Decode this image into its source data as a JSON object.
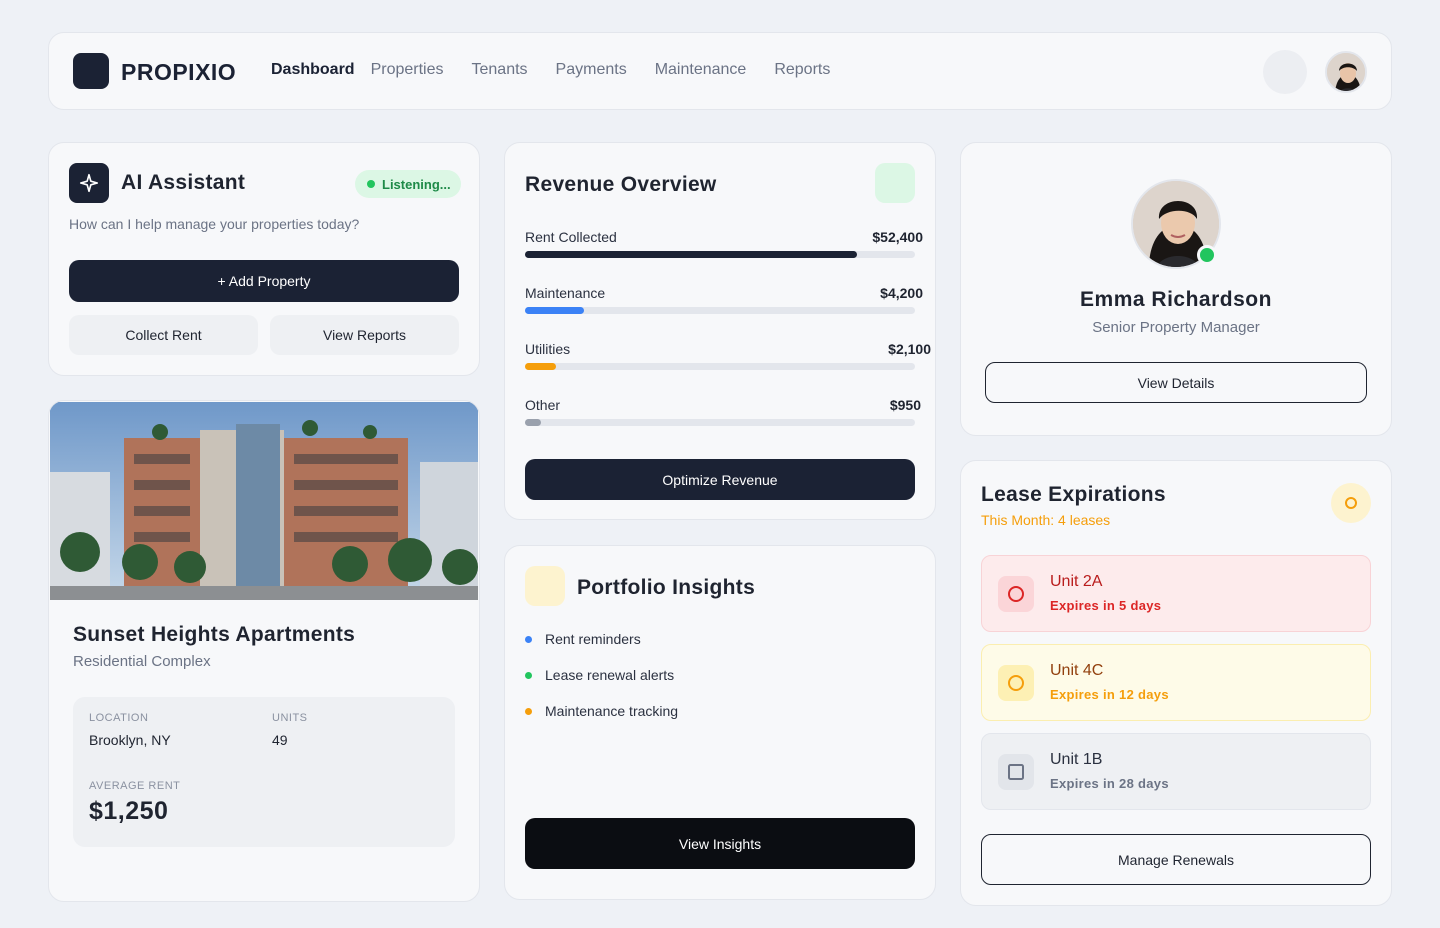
{
  "brand": {
    "name": "PROPIXIO"
  },
  "nav": {
    "links": [
      {
        "label": "Dashboard",
        "active": true
      },
      {
        "label": "Properties"
      },
      {
        "label": "Tenants"
      },
      {
        "label": "Payments"
      },
      {
        "label": "Maintenance"
      },
      {
        "label": "Reports"
      }
    ]
  },
  "ai_assistant": {
    "title": "AI Assistant",
    "status": "Listening...",
    "subtitle": "How can I help manage your properties today?",
    "primary_action": "+ Add Property",
    "secondary_actions": [
      "Collect Rent",
      "View Reports"
    ]
  },
  "property": {
    "name": "Sunset Heights Apartments",
    "type": "Residential Complex",
    "location_label": "LOCATION",
    "location": "Brooklyn, NY",
    "units_label": "UNITS",
    "units": "49",
    "avg_rent_label": "AVERAGE RENT",
    "avg_rent": "$1,250"
  },
  "revenue": {
    "title": "Revenue Overview",
    "rows": [
      {
        "label": "Rent Collected",
        "amount": "$52,400",
        "fill": 0.85,
        "color": "#1b2234"
      },
      {
        "label": "Maintenance",
        "amount": "$4,200",
        "fill": 0.15,
        "color": "#3b82f6"
      },
      {
        "label": "Utilities",
        "amount": "$2,100",
        "fill": 0.08,
        "color": "#f59e0b"
      },
      {
        "label": "Other",
        "amount": "$950",
        "fill": 0.04,
        "color": "#9aa1ad"
      }
    ],
    "action": "Optimize Revenue"
  },
  "insights": {
    "title": "Portfolio Insights",
    "items": [
      {
        "label": "Rent reminders",
        "color": "#3b82f6"
      },
      {
        "label": "Lease renewal alerts",
        "color": "#22c55e"
      },
      {
        "label": "Maintenance tracking",
        "color": "#f59e0b"
      }
    ],
    "action": "View Insights"
  },
  "profile": {
    "name": "Emma Richardson",
    "role": "Senior Property Manager",
    "action": "View Details"
  },
  "leases": {
    "title": "Lease Expirations",
    "subtitle": "This Month: 4 leases",
    "items": [
      {
        "unit": "Unit 2A",
        "expires": "Expires in 5 days",
        "bg": "#fdebec",
        "border": "#f8d3d6",
        "icon_bg": "#fbd5d8",
        "accent": "#dc2626",
        "unit_color": "#b91c1c",
        "icon": "circle"
      },
      {
        "unit": "Unit 4C",
        "expires": "Expires in 12 days",
        "bg": "#fefbe8",
        "border": "#fbeeb0",
        "icon_bg": "#fdf0b4",
        "accent": "#f59e0b",
        "unit_color": "#92400e",
        "icon": "circle"
      },
      {
        "unit": "Unit 1B",
        "expires": "Expires in 28 days",
        "bg": "#eef0f3",
        "border": "#e3e6ec",
        "icon_bg": "#e2e5ea",
        "accent": "#6b7385",
        "unit_color": "#2b3140",
        "icon": "square"
      }
    ],
    "action": "Manage Renewals"
  }
}
